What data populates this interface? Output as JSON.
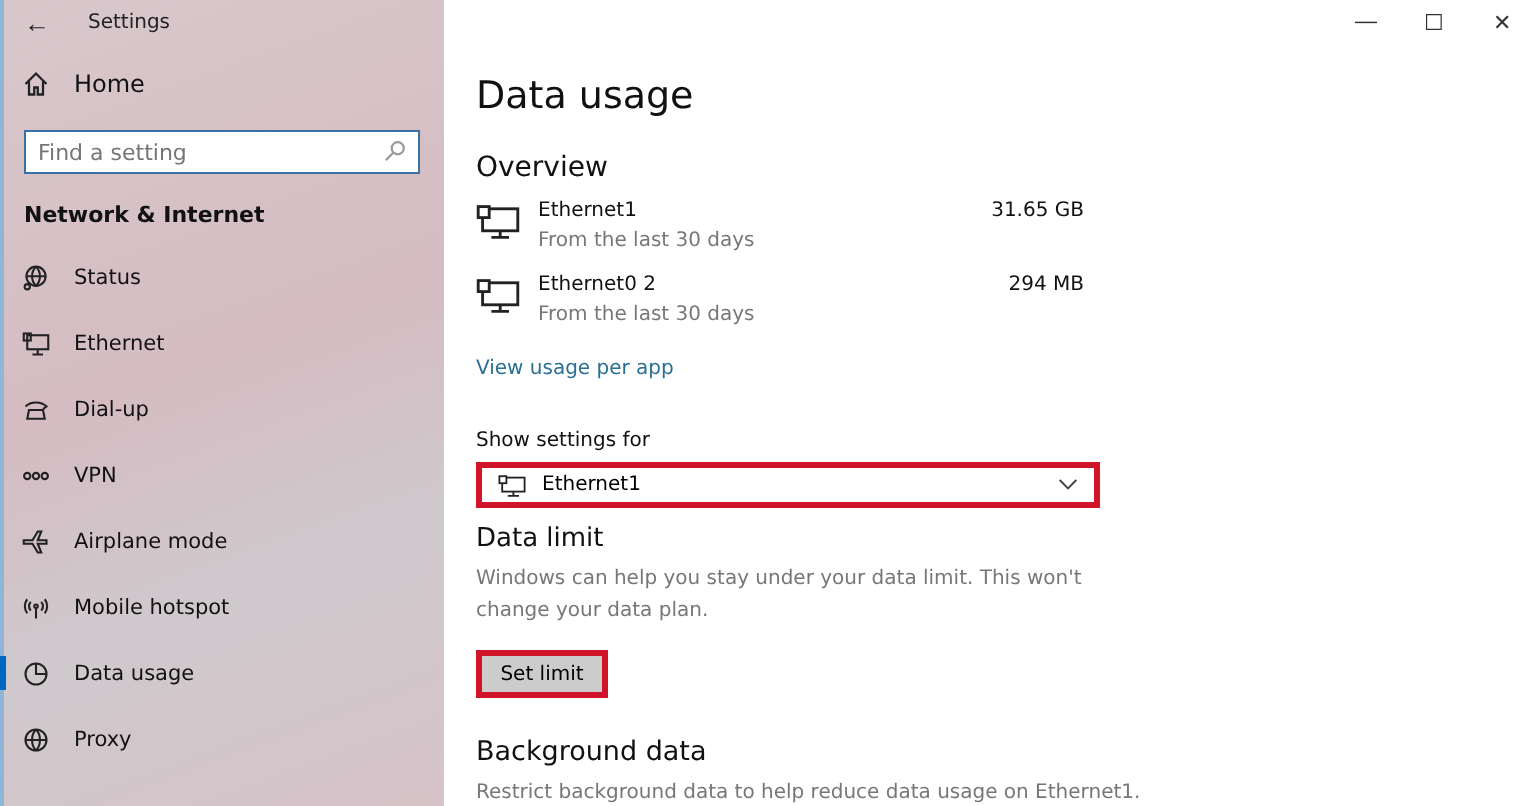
{
  "window": {
    "title": "Settings",
    "back": "←",
    "controls": [
      "—",
      "☐",
      "✕"
    ]
  },
  "sidebar": {
    "home": "Home",
    "search": {
      "placeholder": "Find a setting"
    },
    "heading": "Network & Internet",
    "items": [
      {
        "label": "Status",
        "selected": false
      },
      {
        "label": "Ethernet",
        "selected": false
      },
      {
        "label": "Dial-up",
        "selected": false
      },
      {
        "label": "VPN",
        "selected": false
      },
      {
        "label": "Airplane mode",
        "selected": false
      },
      {
        "label": "Mobile hotspot",
        "selected": false
      },
      {
        "label": "Data usage",
        "selected": true
      },
      {
        "label": "Proxy",
        "selected": false
      }
    ]
  },
  "page": {
    "title": "Data usage",
    "overview": {
      "heading": "Overview",
      "networks": [
        {
          "name": "Ethernet1",
          "period": "From the last 30 days",
          "amount": "31.65 GB"
        },
        {
          "name": "Ethernet0 2",
          "period": "From the last 30 days",
          "amount": "294 MB"
        }
      ],
      "link": "View usage per app"
    },
    "show_settings": {
      "label": "Show settings for",
      "value": "Ethernet1",
      "highlighted": true
    },
    "data_limit": {
      "heading": "Data limit",
      "description": "Windows can help you stay under your data limit. This won't change your data plan.",
      "button": "Set limit",
      "highlighted": true
    },
    "background_data": {
      "heading": "Background data",
      "description": "Restrict background data to help reduce data usage on Ethernet1."
    }
  }
}
